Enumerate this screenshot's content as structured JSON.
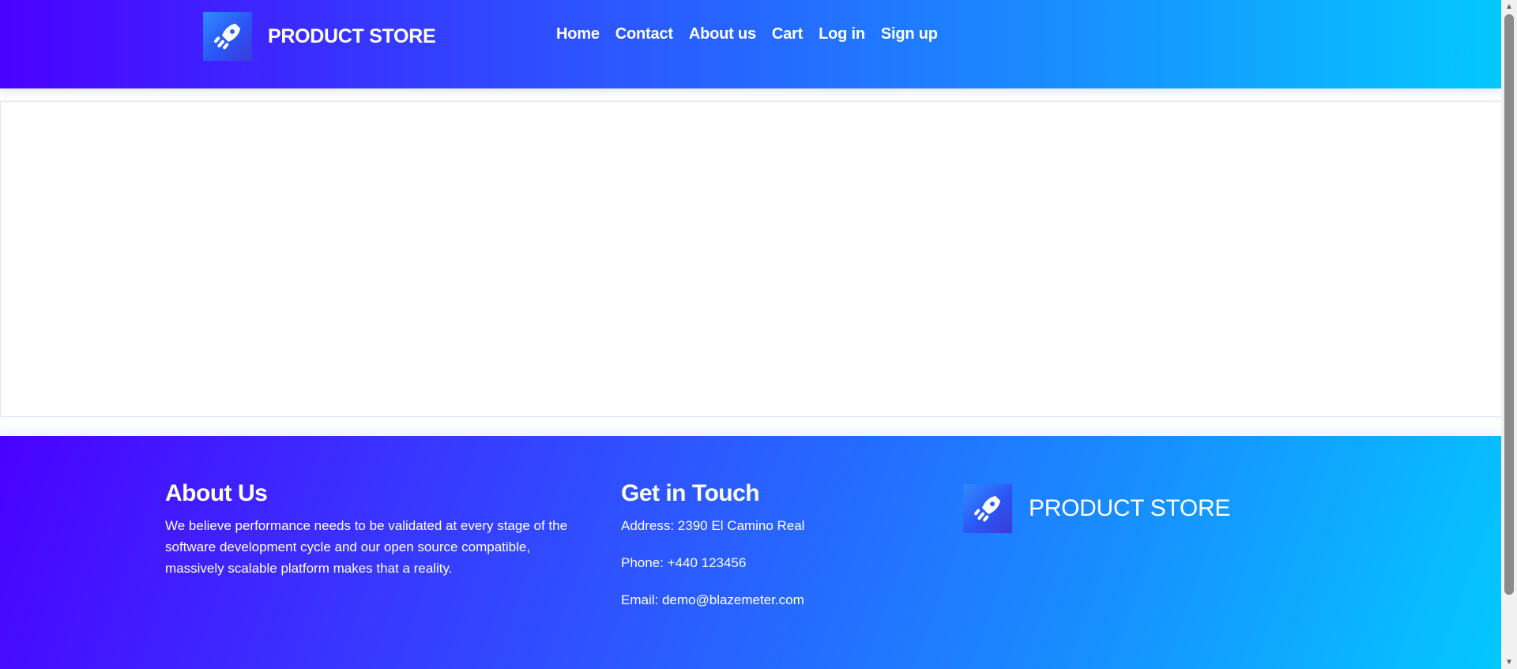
{
  "header": {
    "brand": "PRODUCT STORE",
    "logo_icon": "rocket-icon",
    "nav": [
      {
        "label": "Home"
      },
      {
        "label": "Contact"
      },
      {
        "label": "About us"
      },
      {
        "label": "Cart"
      },
      {
        "label": "Log in"
      },
      {
        "label": "Sign up"
      }
    ]
  },
  "footer": {
    "about": {
      "title": "About Us",
      "text": "We believe performance needs to be validated at every stage of the software development cycle and our open source compatible, massively scalable platform makes that a reality."
    },
    "touch": {
      "title": "Get in Touch",
      "address": "Address: 2390 El Camino Real",
      "phone": "Phone: +440 123456",
      "email": "Email: demo@blazemeter.com"
    },
    "brand": "PRODUCT STORE"
  },
  "colors": {
    "gradient_start": "#4a01ff",
    "gradient_end": "#03c8ff",
    "text": "#ffffff"
  }
}
